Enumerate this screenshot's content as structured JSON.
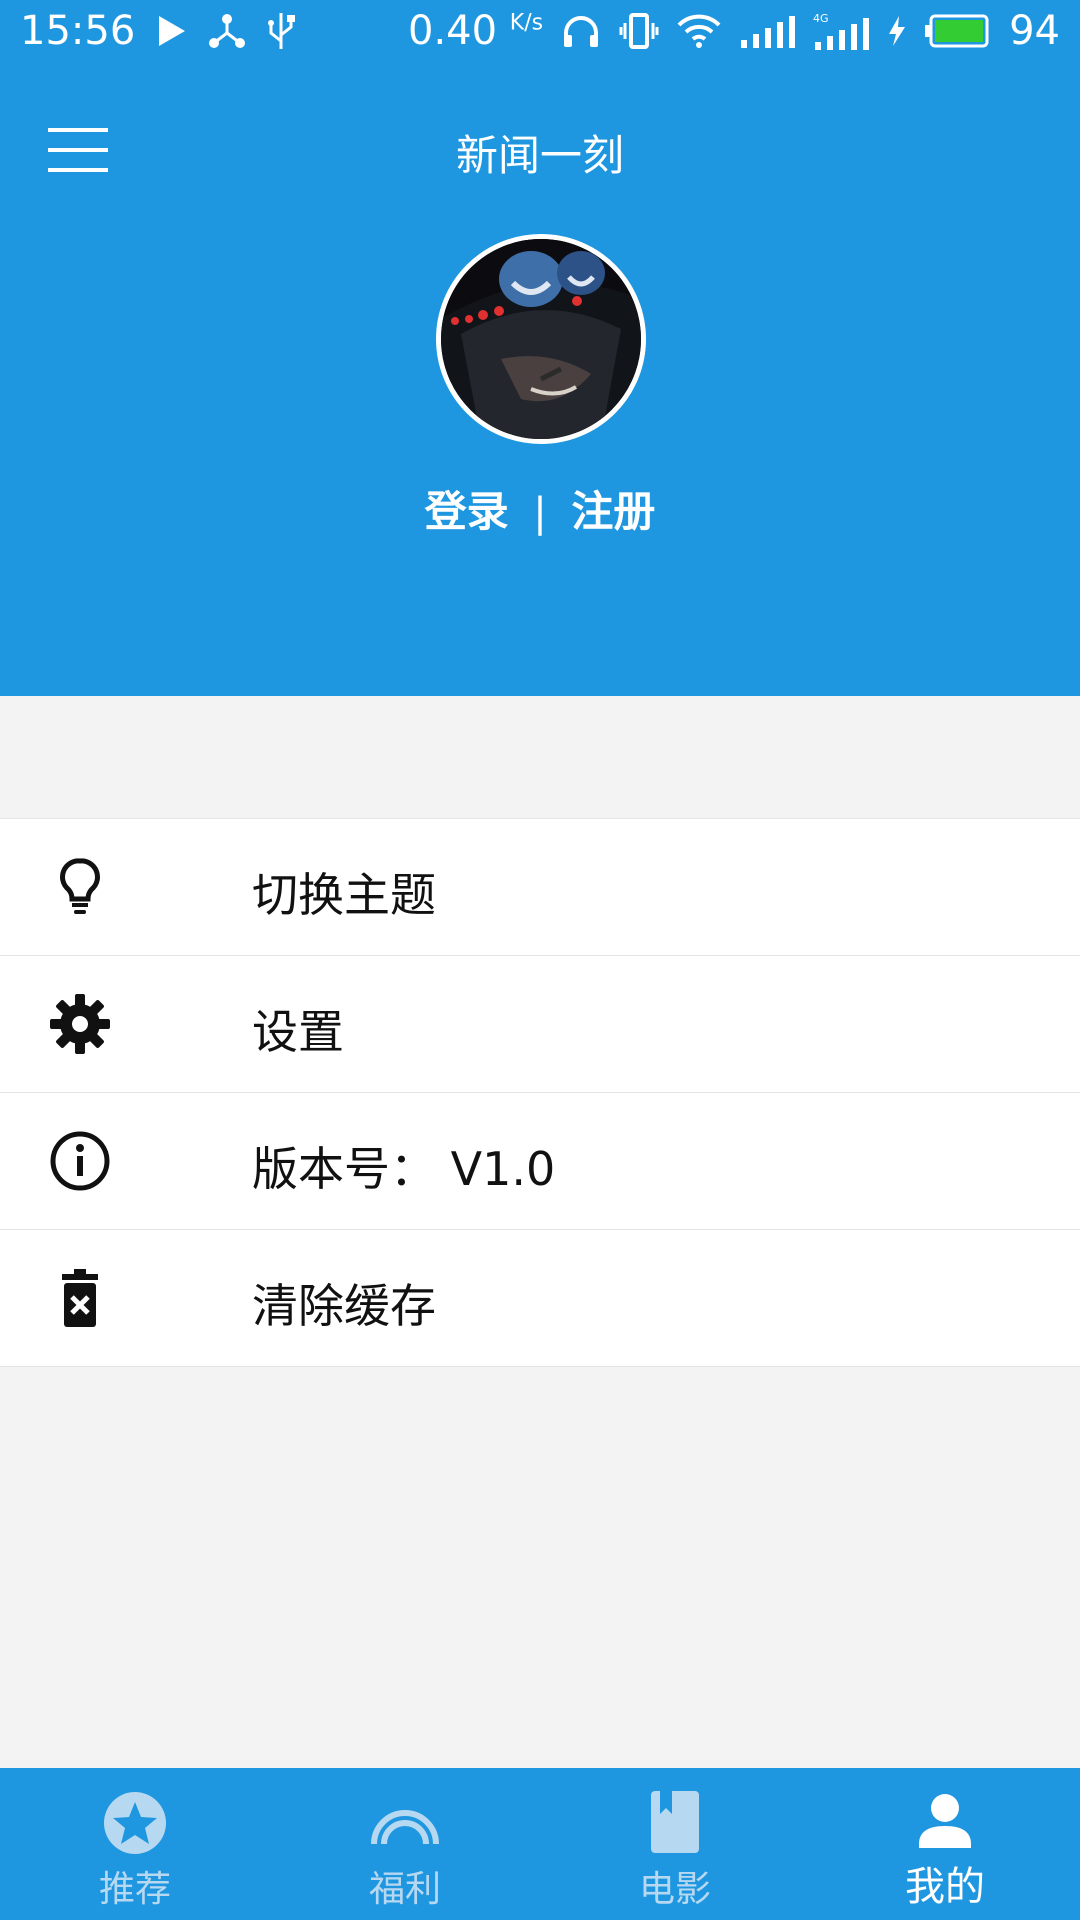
{
  "status_bar": {
    "time": "15:56",
    "speed": "0.40",
    "speed_unit": "K/s",
    "battery": "94",
    "icons": [
      "play-icon",
      "share-nodes-icon",
      "usb-icon",
      "headphones-icon",
      "vibrate-icon",
      "wifi-icon",
      "signal-icon",
      "signal-4g-icon",
      "charging-icon",
      "battery-icon"
    ]
  },
  "toolbar": {
    "title": "新闻一刻",
    "menu_icon": "hamburger-menu-icon"
  },
  "profile": {
    "login_label": "登录",
    "separator": "|",
    "register_label": "注册"
  },
  "menu": {
    "items": [
      {
        "label": "切换主题",
        "icon": "lightbulb-icon"
      },
      {
        "label": "设置",
        "icon": "gear-icon"
      },
      {
        "label": "版本号： V1.0",
        "icon": "info-icon"
      },
      {
        "label": "清除缓存",
        "icon": "trash-icon"
      }
    ]
  },
  "bottom_nav": {
    "tabs": [
      {
        "label": "推荐",
        "icon": "star-icon",
        "active": false
      },
      {
        "label": "福利",
        "icon": "rainbow-icon",
        "active": false
      },
      {
        "label": "电影",
        "icon": "book-icon",
        "active": false
      },
      {
        "label": "我的",
        "icon": "person-icon",
        "active": true
      }
    ]
  },
  "colors": {
    "primary": "#1f97e0",
    "background": "#f3f3f3",
    "inactive_tab": "#b7d8f1",
    "active_tab": "#ffffff",
    "battery_fill": "#33cc33"
  }
}
